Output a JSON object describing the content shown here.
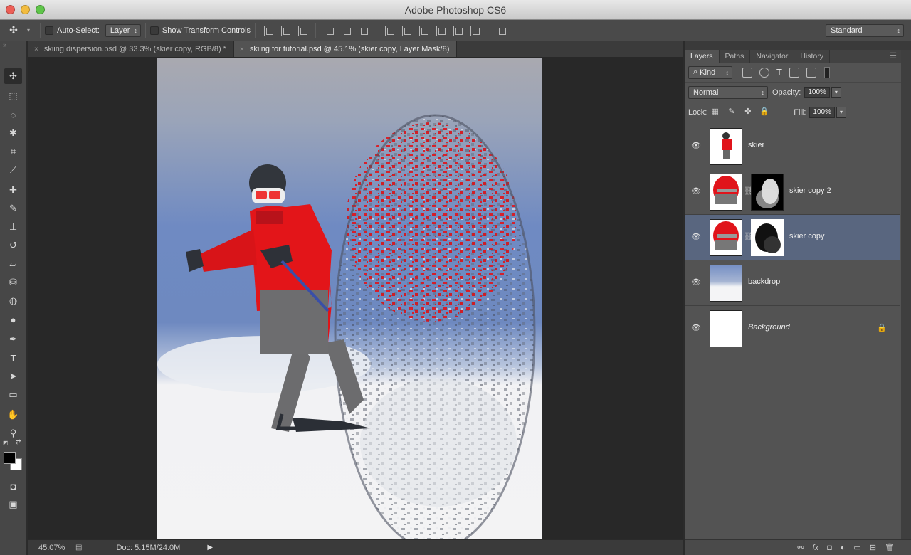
{
  "window": {
    "title": "Adobe Photoshop CS6",
    "lights": [
      "#ec5f57",
      "#f2bc40",
      "#5fc54a"
    ]
  },
  "options_bar": {
    "auto_select_label": "Auto-Select:",
    "auto_select_value": "Layer",
    "show_transform_label": "Show Transform Controls",
    "workspace_value": "Standard"
  },
  "tabs": [
    {
      "label": "skiing dispersion.psd @ 33.3% (skier copy, RGB/8) *",
      "close": "×"
    },
    {
      "label": "skiing for tutorial.psd @ 45.1% (skier copy, Layer Mask/8)",
      "close": "×"
    }
  ],
  "tools": [
    {
      "name": "move-tool",
      "glyph": "✣"
    },
    {
      "name": "marquee-tool",
      "glyph": "⬚"
    },
    {
      "name": "lasso-tool",
      "glyph": "◌"
    },
    {
      "name": "magic-wand-tool",
      "glyph": "✱"
    },
    {
      "name": "crop-tool",
      "glyph": "⌗"
    },
    {
      "name": "eyedropper-tool",
      "glyph": "⟋"
    },
    {
      "name": "healing-brush-tool",
      "glyph": "✚"
    },
    {
      "name": "brush-tool",
      "glyph": "✎"
    },
    {
      "name": "clone-stamp-tool",
      "glyph": "⊥"
    },
    {
      "name": "history-brush-tool",
      "glyph": "↺"
    },
    {
      "name": "eraser-tool",
      "glyph": "▱"
    },
    {
      "name": "paint-bucket-tool",
      "glyph": "⛁"
    },
    {
      "name": "blur-tool",
      "glyph": "◍"
    },
    {
      "name": "dodge-tool",
      "glyph": "●"
    },
    {
      "name": "pen-tool",
      "glyph": "✒"
    },
    {
      "name": "type-tool",
      "glyph": "T"
    },
    {
      "name": "path-selection-tool",
      "glyph": "➤"
    },
    {
      "name": "shape-tool",
      "glyph": "▭"
    },
    {
      "name": "hand-tool",
      "glyph": "✋"
    },
    {
      "name": "zoom-tool",
      "glyph": "⚲"
    },
    {
      "name": "quick-mask-tool",
      "glyph": "◘"
    },
    {
      "name": "screen-mode-tool",
      "glyph": "▣"
    }
  ],
  "colors": {
    "foreground": "#000000",
    "background": "#ffffff",
    "selected_layer": "#59667f",
    "jacket_red": "#e0141b"
  },
  "status": {
    "zoom": "45.07%",
    "doc": "Doc: 5.15M/24.0M"
  },
  "panel": {
    "tabs": [
      "Layers",
      "Paths",
      "Navigator",
      "History"
    ],
    "filter_label": "Kind",
    "blend_mode": "Normal",
    "opacity_label": "Opacity:",
    "opacity_value": "100%",
    "lock_label": "Lock:",
    "fill_label": "Fill:",
    "fill_value": "100%",
    "layers": [
      {
        "name": "skier",
        "has_mask": false,
        "selected": false,
        "locked": false
      },
      {
        "name": "skier copy 2",
        "has_mask": true,
        "selected": false,
        "locked": false
      },
      {
        "name": "skier copy",
        "has_mask": true,
        "selected": true,
        "locked": false
      },
      {
        "name": "backdrop",
        "has_mask": false,
        "selected": false,
        "locked": false
      },
      {
        "name": "Background",
        "has_mask": false,
        "selected": false,
        "locked": true
      }
    ],
    "footer_icons": [
      "link-icon",
      "fx-icon",
      "mask-icon",
      "adjustment-icon",
      "folder-icon",
      "new-layer-icon",
      "trash-icon"
    ],
    "footer_glyphs": [
      "⚯",
      "fx",
      "◘",
      "◐",
      "▭",
      "⊞",
      "🗑"
    ]
  }
}
